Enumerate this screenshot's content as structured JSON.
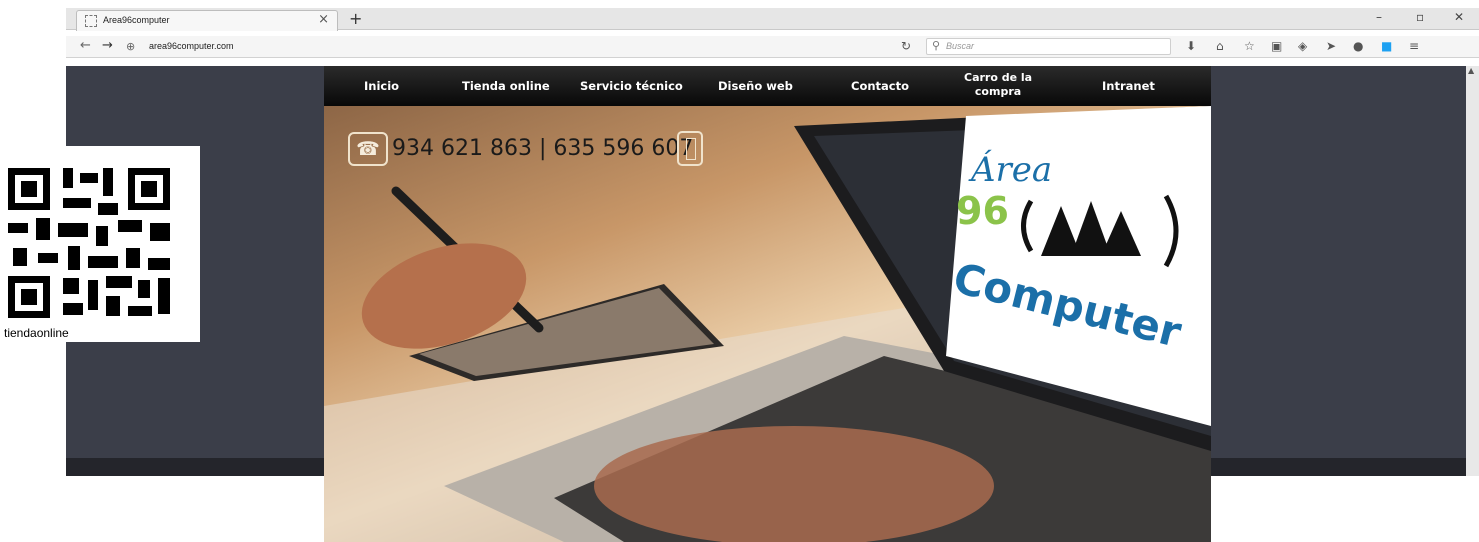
{
  "browser": {
    "tab_title": "Area96computer",
    "tab_close": "×",
    "new_tab": "+",
    "url": "area96computer.com",
    "search_placeholder": "Buscar",
    "window_controls": [
      "–",
      "▫",
      "✕"
    ],
    "toolbar_icons": [
      "download-icon",
      "home-icon",
      "bookmark-star-icon",
      "clipboard-icon",
      "pocket-icon",
      "send-icon",
      "chat-icon",
      "skype-icon",
      "menu-icon"
    ]
  },
  "site": {
    "menu": {
      "items": [
        "Inicio",
        "Tienda online",
        "Servicio técnico",
        "Diseño web",
        "Contacto"
      ],
      "cart_line1": "Carro de la",
      "cart_line2": "compra",
      "intranet": "Intranet"
    },
    "phones": "934 621 863 | 635 596 607",
    "logo": {
      "line1": "Área",
      "line2": "96",
      "line3": "Computer"
    }
  },
  "qr": {
    "caption": "tiendaonline"
  },
  "colors": {
    "page_bg": "#3b3e49",
    "menu_bg": "#111111",
    "logo_green": "#8bc34a",
    "logo_blue": "#1b6fa8"
  }
}
